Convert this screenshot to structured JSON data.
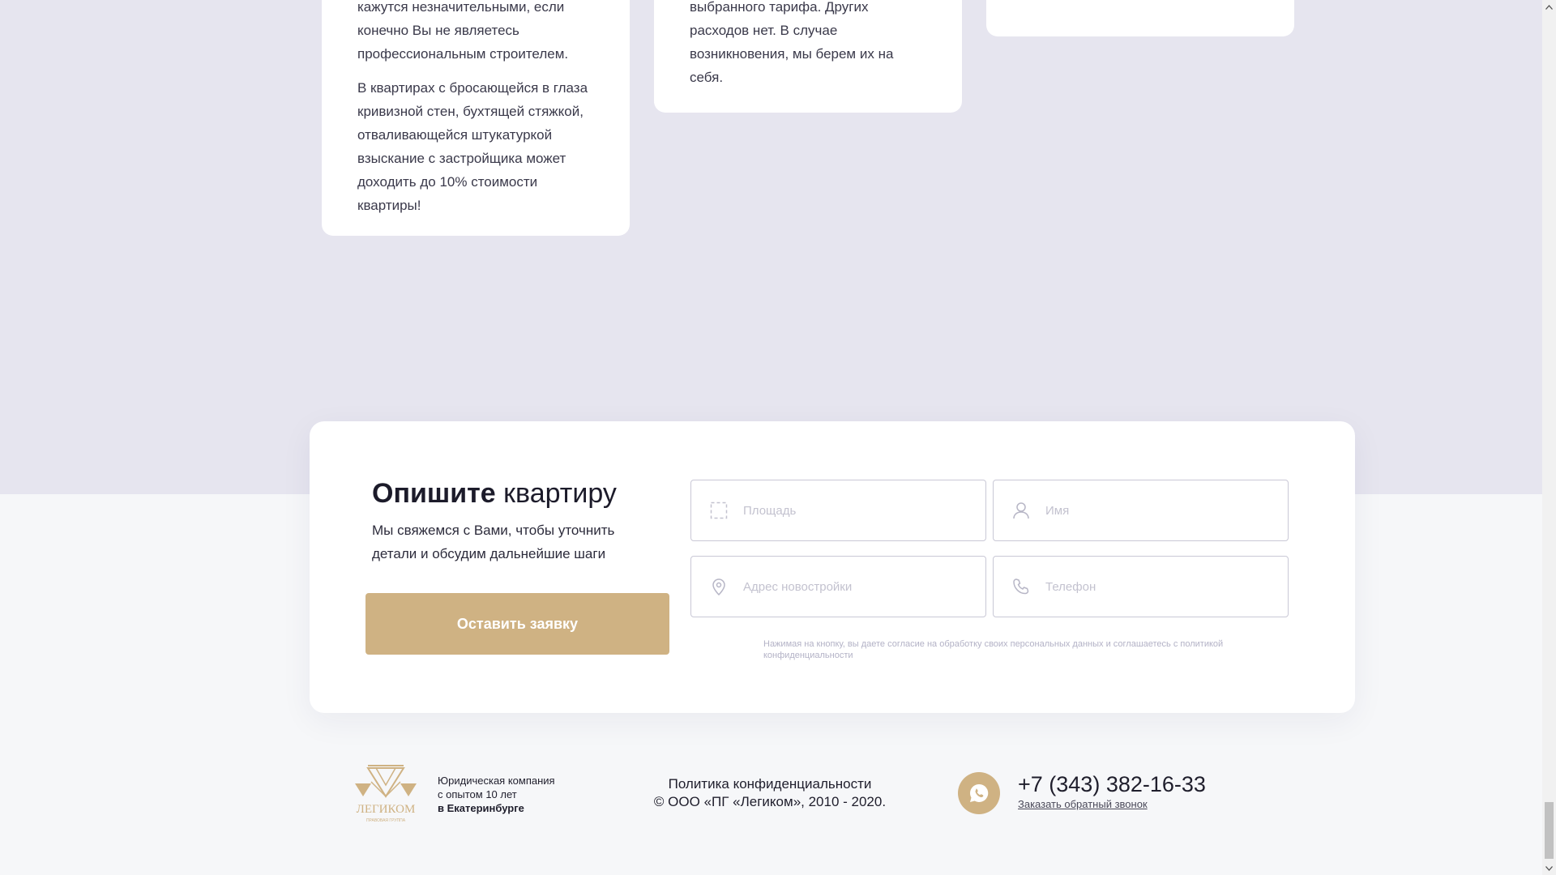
{
  "cards": {
    "card1": {
      "paragraph1": "кажутся незначительными, если конечно Вы не являетесь профессиональным строителем.",
      "paragraph2": "В квартирах с бросающейся в глаза кривизной стен, бухтящей стяжкой, отваливающейся штукатуркой взыскание с застройщика может доходить до 10% стоимости квартиры!"
    },
    "card2": {
      "paragraph1": "выбранного тарифа. Других расходов нет. В случае возникновения, мы берем их на себя."
    }
  },
  "form": {
    "title_bold": "Опишите",
    "title_rest": " квартиру",
    "description": "Мы свяжемся с Вами, чтобы уточнить детали и обсудим дальнейшие шаги",
    "submit_label": "Оставить заявку",
    "fields": {
      "area_placeholder": "Площадь",
      "name_placeholder": "Имя",
      "address_placeholder": "Адрес новостройки",
      "phone_placeholder": "Телефон"
    },
    "consent_text": "Нажимая на кнопку, вы даете согласие на обработку своих персональных данных и соглашаетесь с политикой конфиденциальности"
  },
  "footer": {
    "logo_text": "ЛЕГИКОМ",
    "logo_subtext": "ПРАВОВАЯ ГРУППА",
    "tagline_line1": "Юридическая компания",
    "tagline_line2": "с опытом 10 лет",
    "tagline_line3": "в Екатеринбурге",
    "privacy_link": "Политика конфиденциальности",
    "copyright": "© ООО «ПГ «Легиком», 2010 - 2020.",
    "phone": "+7 (343) 382-16-33",
    "callback_link": "Заказать обратный звонок"
  },
  "colors": {
    "accent": "#cfb283",
    "page_bg_top": "#e6e5ef",
    "page_bg_bottom": "#f6f7f9"
  },
  "icons": {
    "area": "dashed-square-icon",
    "name": "user-icon",
    "address": "location-pin-icon",
    "phone": "phone-icon",
    "messenger": "whatsapp-icon"
  }
}
